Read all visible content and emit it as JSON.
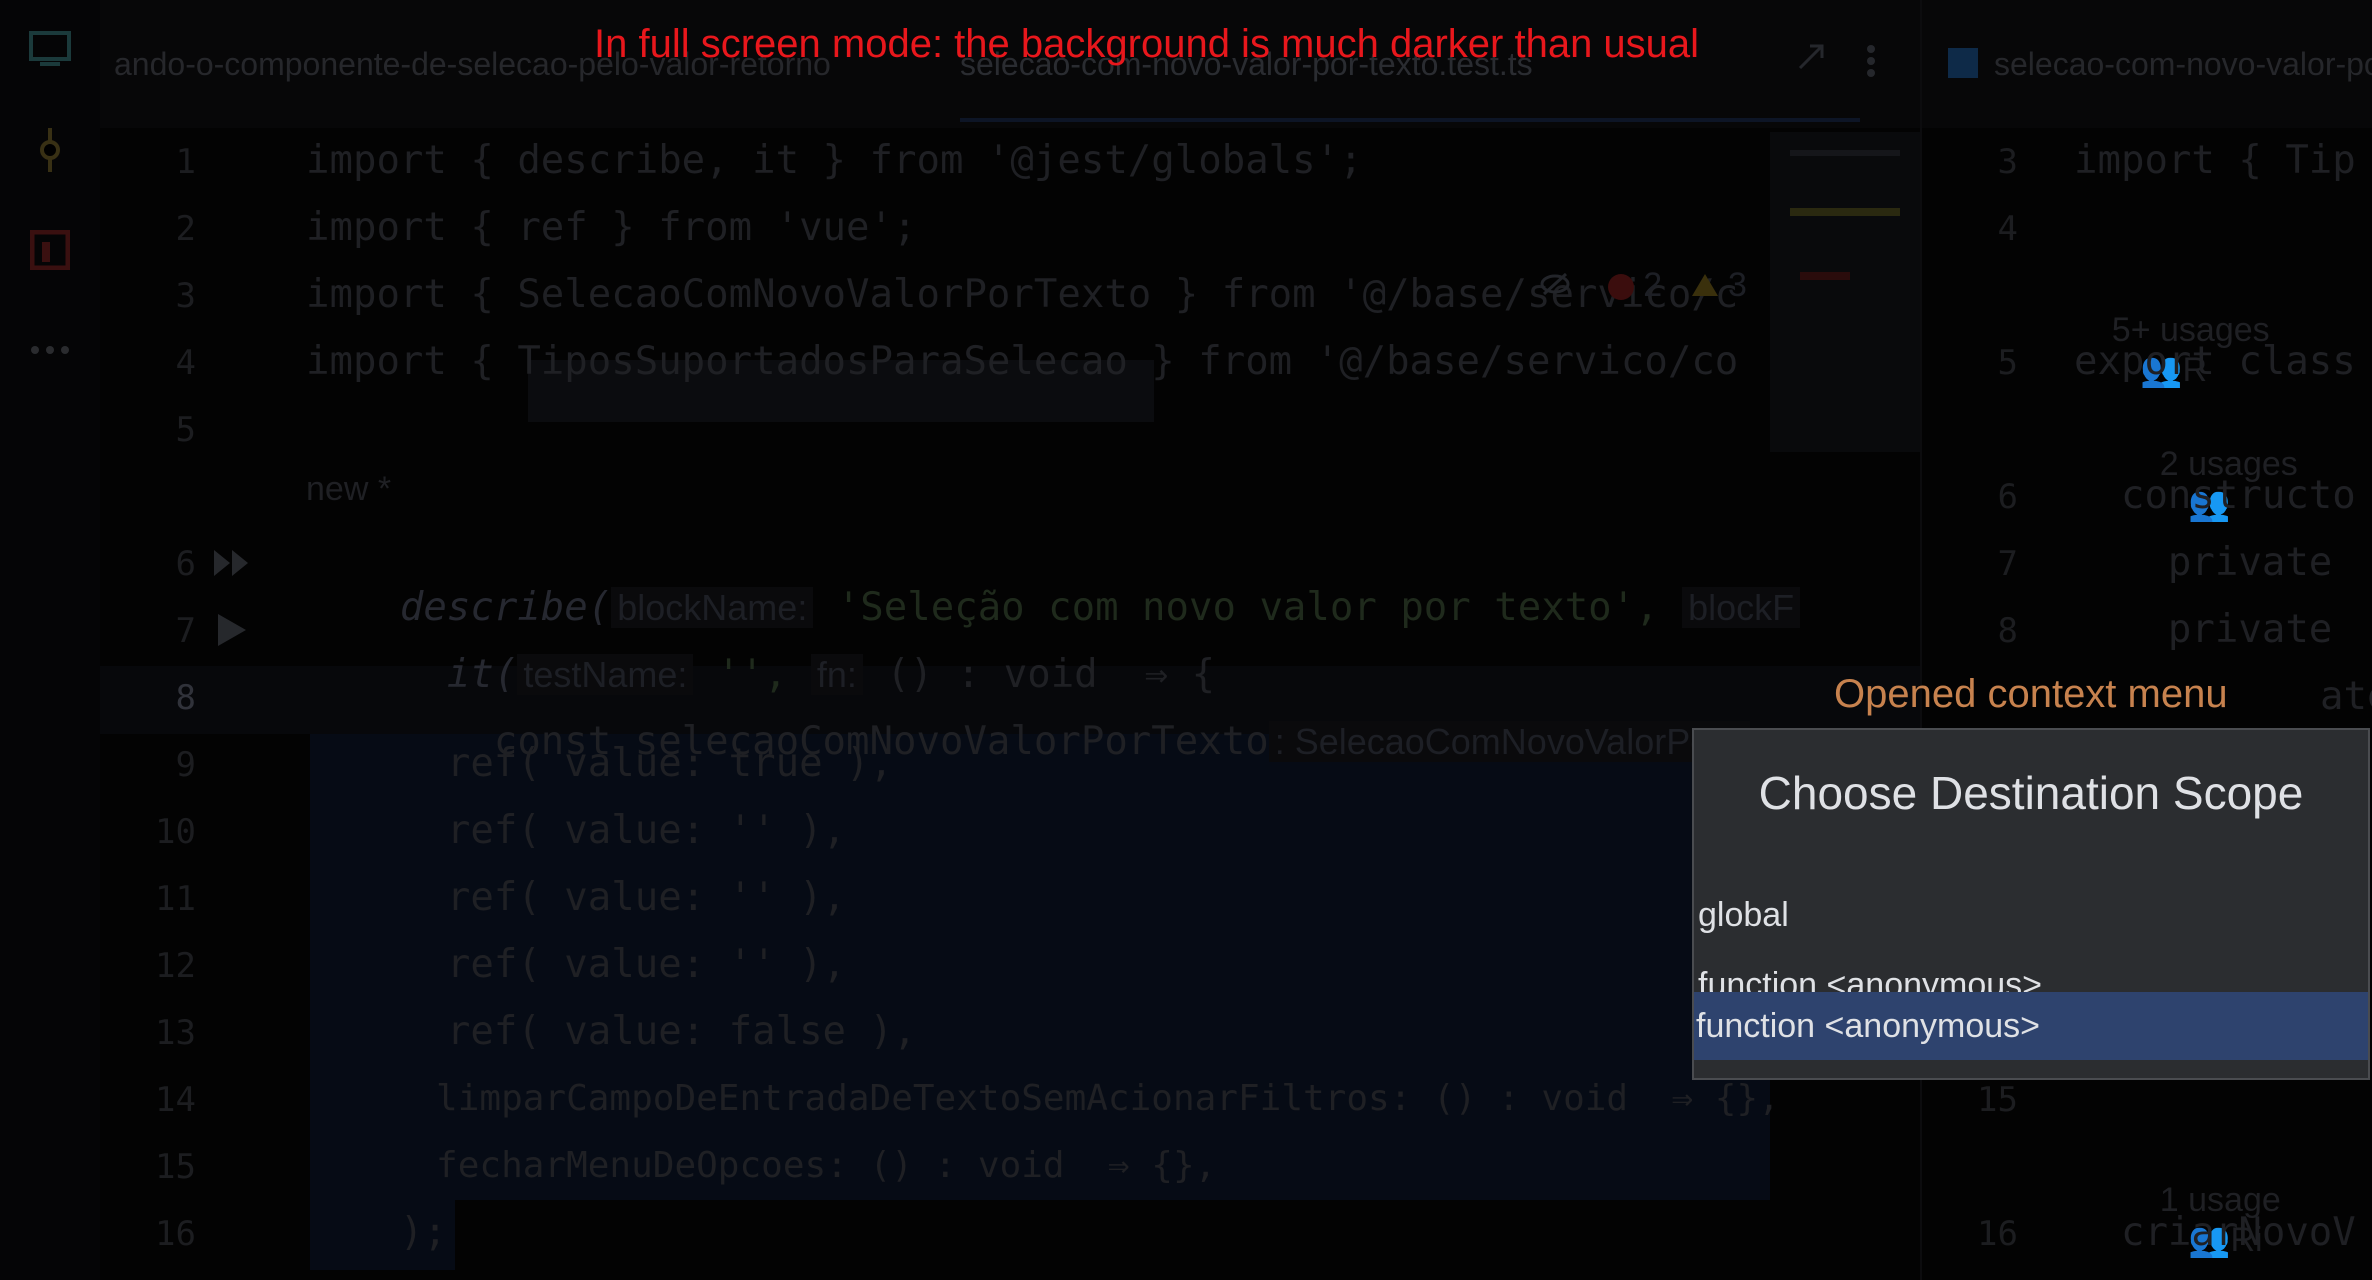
{
  "annotations": {
    "fullscreen_note": "In full screen mode: the background is much darker than usual",
    "context_note": "Opened context menu"
  },
  "tabs": {
    "left_tab": "ando-o-componente-de-selecao-pelo-valor-retorno",
    "active_tab": "selecao-com-novo-valor-por-texto.test.ts",
    "right_tab": "selecao-com-novo-valor-por-"
  },
  "inspections": {
    "errors": "2",
    "warnings": "3"
  },
  "editor_left": {
    "line_numbers": [
      "1",
      "2",
      "3",
      "4",
      "5",
      "6",
      "7",
      "8",
      "9",
      "10",
      "11",
      "12",
      "13",
      "14",
      "15",
      "16"
    ],
    "lines": {
      "l1": "import { describe, it } from '@jest/globals';",
      "l2": "import { ref } from 'vue';",
      "l3": "import { SelecaoComNovoValorPorTexto } from '@/base/servico/c",
      "l4": "import { TiposSuportadosParaSelecao } from '@/base/servico/co",
      "meta": "new *",
      "l6_code": "describe(",
      "l6_hint": "blockName:",
      "l6_str": "'Seleção com novo valor por texto',",
      "l6_hint2": "blockF",
      "l7_code": "  it(",
      "l7_hint": "testName:",
      "l7_str": "'',",
      "l7_hint2": "fn:",
      "l7_rest": "() : void  ⇒ {",
      "l8_code": "    const selecaoComNovoValorPorTexto",
      "l8_hint": ": SelecaoComNovoValorPorT",
      "l9": "      ref( value: true ),",
      "l10": "      ref( value: '' ),",
      "l11": "      ref( value: '' ),",
      "l12": "      ref( value: '' ),",
      "l13": "      ref( value: false ),",
      "l14": "      limparCampoDeEntradaDeTextoSemAcionarFiltros: () : void  ⇒ {},",
      "l15": "      fecharMenuDeOpcoes: () : void  ⇒ {},",
      "l16": "    );"
    }
  },
  "editor_right": {
    "line_numbers": [
      "3",
      "4",
      "5",
      "6",
      "7",
      "8",
      "15",
      "16"
    ],
    "lines": {
      "r3": "import { Tip",
      "r_usages1": "5+ usages",
      "r_author1": "R",
      "r5": "export class",
      "r_usages2": "2 usages",
      "r6": "  constructo",
      "r7": "    private",
      "r8": "    private",
      "r9": "ate",
      "r_usages3": "1 usage",
      "r_author3": "Ri",
      "r16": "  criarNovoV"
    }
  },
  "popup": {
    "title": "Choose Destination Scope",
    "items": [
      {
        "label": "global",
        "selected": false
      },
      {
        "label": "function <anonymous>",
        "selected": false
      },
      {
        "label": "function <anonymous>",
        "selected": true
      }
    ]
  },
  "colors": {
    "popup_bg": "#2b2d30",
    "popup_selected": "#2e436e",
    "annotation_red": "#e8171c",
    "annotation_orange": "#c7824e"
  }
}
